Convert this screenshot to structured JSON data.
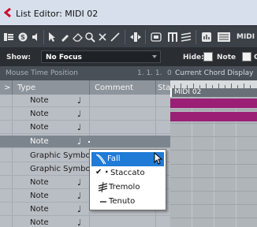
{
  "window": {
    "title": "List Editor: MIDI 02"
  },
  "toolbar": {
    "trailing_text": "MIDI"
  },
  "filter_bar": {
    "show_label": "Show:",
    "show_value": "No Focus",
    "hide_label": "Hide:",
    "hide_note_label": "Note",
    "hide_next_label": "C"
  },
  "info_bar": {
    "mouse_time_label": "Mouse Time Position",
    "mouse_time_value": "1. 1. 1.",
    "sep_char": "0",
    "chord_label": "Current Chord Display"
  },
  "table": {
    "expander": ">",
    "columns": [
      "Type",
      "Comment",
      "Sta"
    ],
    "rows": [
      {
        "type": "Note",
        "icon": "♩"
      },
      {
        "type": "Note",
        "icon": "♩"
      },
      {
        "type": "Note",
        "icon": "♩"
      },
      {
        "type": "Note",
        "icon": "♩"
      },
      {
        "type": "Graphic Symbol",
        "icon": ""
      },
      {
        "type": "Graphic Symbol",
        "icon": ""
      },
      {
        "type": "Note",
        "icon": "♩"
      },
      {
        "type": "Note",
        "icon": "♩"
      },
      {
        "type": "Note",
        "icon": "♩"
      },
      {
        "type": "Note",
        "icon": "♩"
      }
    ]
  },
  "part": {
    "label": "MIDI 02"
  },
  "menu": {
    "items": [
      {
        "label": "Fall",
        "icon": "fall-icon"
      },
      {
        "label": "Staccato",
        "icon": "staccato-icon"
      },
      {
        "label": "Tremolo",
        "icon": "tremolo-icon"
      },
      {
        "label": "Tenuto",
        "icon": "tenuto-icon"
      }
    ],
    "checked_item": "Staccato",
    "highlighted_item": "Fall"
  },
  "colors": {
    "accent": "#1f7bd6",
    "midi_bar": "#9b1f75"
  }
}
